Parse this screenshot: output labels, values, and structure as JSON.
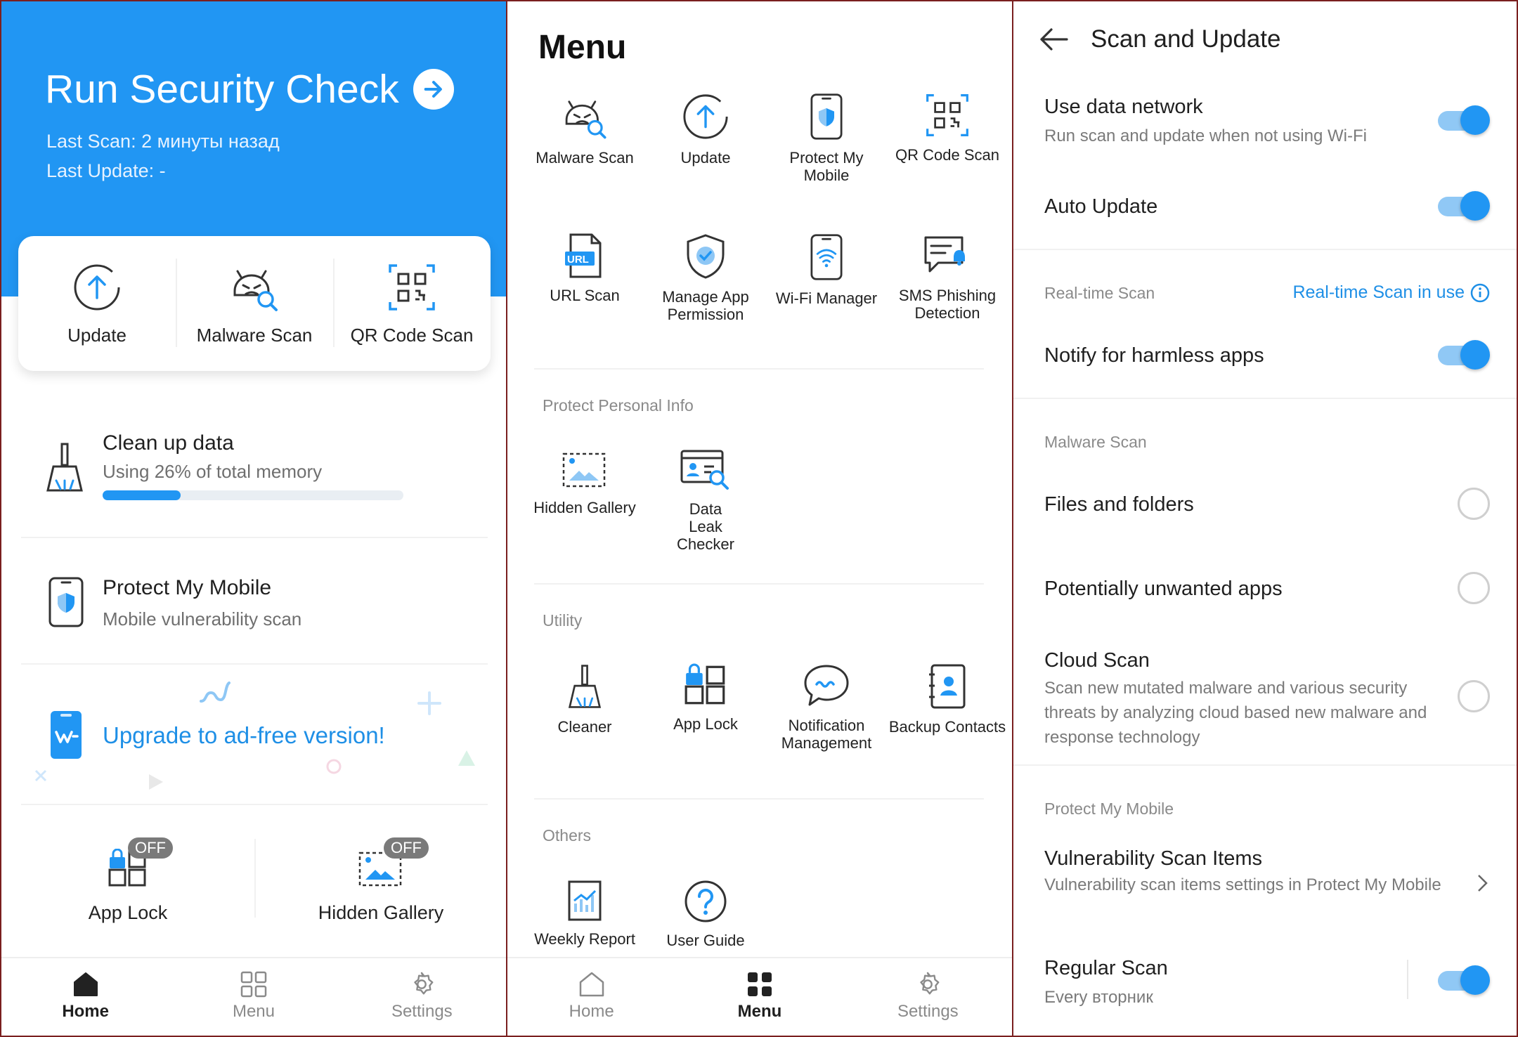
{
  "home": {
    "hero_title": "Run Security Check",
    "last_scan": "Last Scan: 2 минуты назад",
    "last_update": "Last Update: -",
    "quick": [
      "Update",
      "Malware Scan",
      "QR Code Scan"
    ],
    "cleanup": {
      "title": "Clean up data",
      "sub": "Using 26% of total memory",
      "percent": 26
    },
    "protect": {
      "title": "Protect My Mobile",
      "sub": "Mobile vulnerability scan"
    },
    "upgrade": "Upgrade to ad-free version!",
    "app_lock": {
      "label": "App Lock",
      "badge": "OFF"
    },
    "hidden_gallery": {
      "label": "Hidden Gallery",
      "badge": "OFF"
    },
    "nav": [
      "Home",
      "Menu",
      "Settings"
    ]
  },
  "menu": {
    "title": "Menu",
    "tiles": {
      "malware_scan": "Malware Scan",
      "update": "Update",
      "protect_my_mobile": "Protect My Mobile",
      "qr_code_scan": "QR Code Scan",
      "url_scan": "URL Scan",
      "url_badge": "URL",
      "manage_app_permission": "Manage App Permission",
      "wifi_manager": "Wi-Fi Manager",
      "sms_phishing_detection": "SMS Phishing Detection",
      "hidden_gallery": "Hidden Gallery",
      "data_leak_checker": "Data Leak Checker",
      "cleaner": "Cleaner",
      "app_lock": "App Lock",
      "notification_management": "Notification Management",
      "backup_contacts": "Backup Contacts",
      "weekly_report": "Weekly Report",
      "user_guide": "User Guide"
    },
    "sections": {
      "protect_personal_info": "Protect Personal Info",
      "utility": "Utility",
      "others": "Others"
    },
    "nav": [
      "Home",
      "Menu",
      "Settings"
    ]
  },
  "settings": {
    "title": "Scan and Update",
    "use_data_network": {
      "title": "Use data network",
      "sub": "Run scan and update when not using Wi-Fi",
      "on": true
    },
    "auto_update": {
      "title": "Auto Update",
      "on": true
    },
    "realtime_head": "Real-time Scan",
    "realtime_link": "Real-time Scan in use",
    "notify_harmless": {
      "title": "Notify for harmless apps",
      "on": true
    },
    "malware_head": "Malware Scan",
    "files_folders": {
      "title": "Files and folders",
      "checked": false
    },
    "pua": {
      "title": "Potentially unwanted apps",
      "checked": false
    },
    "cloud_scan": {
      "title": "Cloud Scan",
      "sub": "Scan new mutated malware and various security threats by analyzing cloud based new malware and response technology",
      "checked": false
    },
    "protect_head": "Protect My Mobile",
    "vuln_items": {
      "title": "Vulnerability Scan Items",
      "sub": "Vulnerability scan items settings in Protect My Mobile"
    },
    "regular_scan": {
      "title": "Regular Scan",
      "sub": "Every вторник",
      "on": true
    }
  },
  "colors": {
    "accent": "#2196f3",
    "link": "#1e8fe6",
    "toggle_track": "#90c8f5"
  }
}
